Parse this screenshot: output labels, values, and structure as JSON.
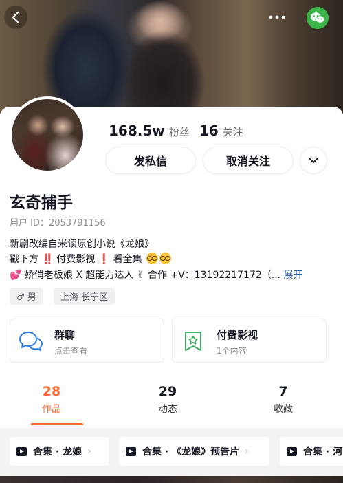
{
  "header": {
    "back_icon": "chevron-left-icon",
    "more_icon": "more-horizontal-icon",
    "share_icon": "wechat-icon",
    "wechat_color": "#3cb44a"
  },
  "profile": {
    "followers_count": "168.5w",
    "followers_label": "粉丝",
    "following_count": "16",
    "following_label": "关注",
    "message_button": "发私信",
    "unfollow_button": "取消关注",
    "name": "玄奇捕手",
    "user_id": "用户 ID：2053791156",
    "bio_line1": "新剧改编自米读原创小说《龙娘》",
    "bio_line2_a": "戳下方",
    "bio_line2_excl1": "‼️",
    "bio_line2_b": "付费影视",
    "bio_line2_excl2": "❗",
    "bio_line2_c": "看全集",
    "bio_line3": "💕 娇俏老板娘 X 超能力达人 ✌ 合作 +V：13192217172（...",
    "bio_expand": "展开",
    "gender": "♂ 男",
    "location": "上海 长宁区"
  },
  "features": [
    {
      "title": "群聊",
      "subtitle": "点击查看",
      "icon": "chat-bubbles-icon"
    },
    {
      "title": "付费影视",
      "subtitle": "1个内容",
      "icon": "star-bookmark-icon"
    }
  ],
  "tabs": [
    {
      "count": "28",
      "label": "作品"
    },
    {
      "count": "29",
      "label": "动态"
    },
    {
      "count": "7",
      "label": "收藏"
    }
  ],
  "accent_color": "#fe6a2f",
  "collections": [
    {
      "label": "合集 · 龙娘"
    },
    {
      "label": "合集 · 《龙娘》预告片"
    },
    {
      "label": "合集 · 河"
    }
  ]
}
